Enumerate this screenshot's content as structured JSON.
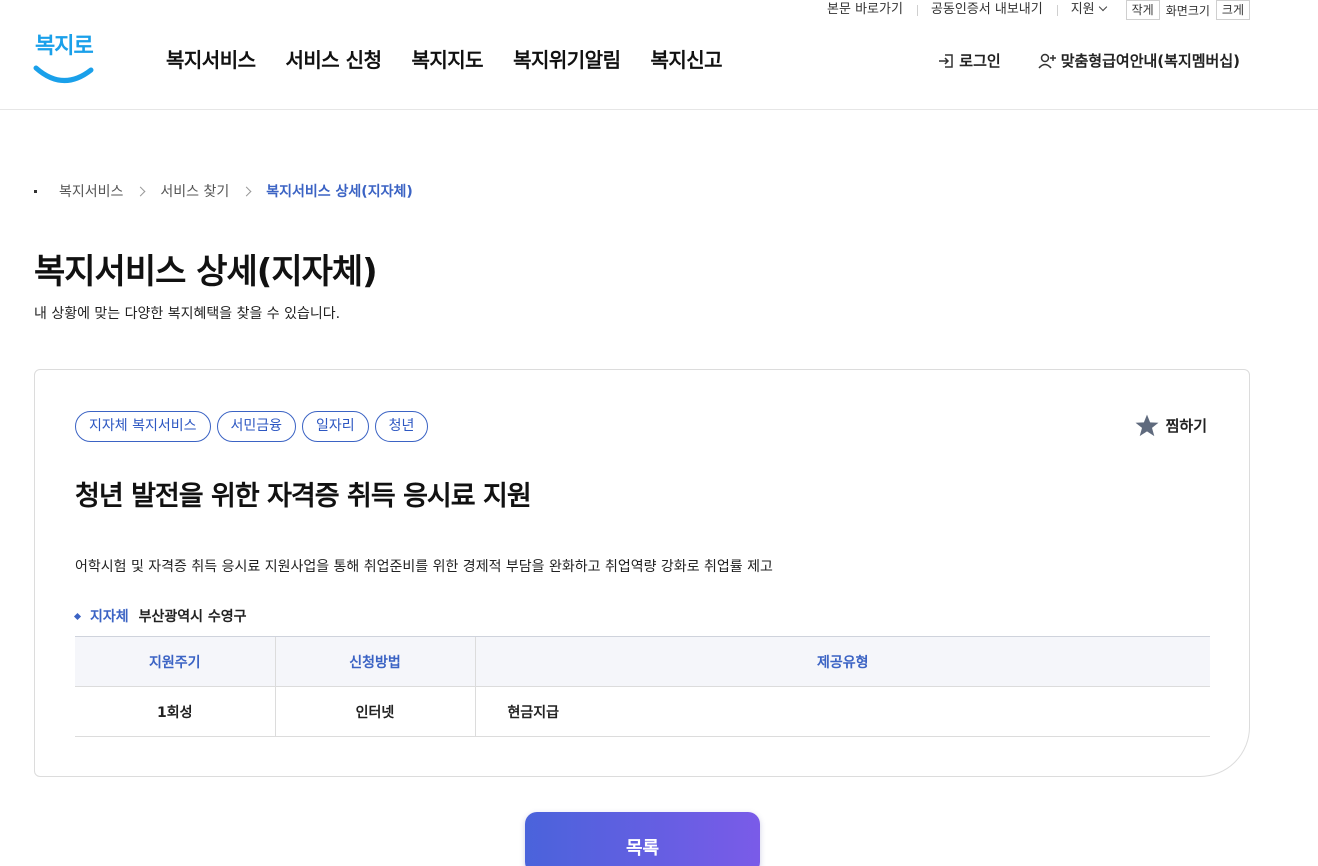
{
  "utility": {
    "skip_to_content": "본문 바로가기",
    "cert_export": "공동인증서 내보내기",
    "support": "지원",
    "text_small": "작게",
    "text_size_label": "화면크기",
    "text_large": "크게"
  },
  "header": {
    "logo_text": "복지로",
    "nav": [
      "복지서비스",
      "서비스 신청",
      "복지지도",
      "복지위기알림",
      "복지신고"
    ],
    "login": "로그인",
    "membership": "맞춤형급여안내(복지멤버십)"
  },
  "breadcrumb": [
    "복지서비스",
    "서비스 찾기",
    "복지서비스 상세(지자체)"
  ],
  "page": {
    "title": "복지서비스 상세(지자체)",
    "description": "내 상황에 맞는 다양한 복지혜택을 찾을 수 있습니다."
  },
  "service": {
    "tags": [
      "지자체 복지서비스",
      "서민금융",
      "일자리",
      "청년"
    ],
    "favorite_label": "찜하기",
    "title": "청년 발전을 위한 자격증 취득 응시료 지원",
    "description": "어학시험 및 자격증 취득 응시료 지원사업을 통해 취업준비를 위한 경제적 부담을 완화하고 취업역량 강화로 취업률 제고",
    "region_label": "지자체",
    "region_value": "부산광역시 수영구",
    "table": {
      "headers": [
        "지원주기",
        "신청방법",
        "제공유형"
      ],
      "row": [
        "1회성",
        "인터넷",
        "현금지급"
      ]
    }
  },
  "list_button": "목록",
  "colors": {
    "accent": "#3b63c4",
    "logo": "#1aa0ea",
    "button_gradient_start": "#4a63db",
    "button_gradient_end": "#7a5be8"
  }
}
